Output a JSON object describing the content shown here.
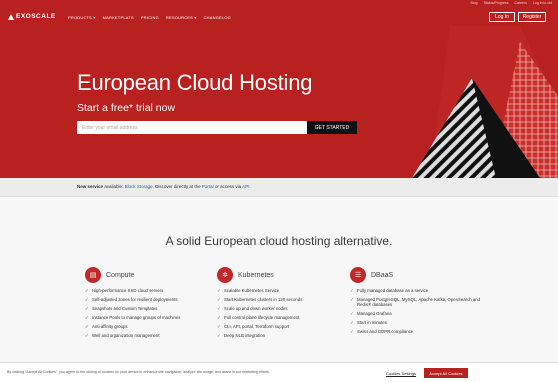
{
  "topbar": {
    "links": [
      "Blog",
      "Status/Progress",
      "Careers",
      "Log in to old"
    ]
  },
  "nav": {
    "logo": "EXOSCALE",
    "menu": [
      "PRODUCTS",
      "MARKETPLATS",
      "PRICING",
      "RESOURCES",
      "CHANGELOG"
    ],
    "login": "Log In",
    "register": "Register"
  },
  "hero": {
    "title": "European Cloud Hosting",
    "subtitle": "Start a free* trial now",
    "email_placeholder": "Enter your email address",
    "cta": "GET STARTED",
    "colors": {
      "brand": "#b8211f",
      "cta": "#111111"
    }
  },
  "news": {
    "label": "New service",
    "text_before": "available:",
    "link1": "Block Storage",
    "text_mid": ". Discover directly at the",
    "link2": "Portal",
    "text_mid2": "or access via",
    "link3": "API",
    "text_end": "."
  },
  "main": {
    "title": "A solid European cloud hosting alternative."
  },
  "columns": [
    {
      "title": "Compute",
      "icon": "server-icon",
      "items": [
        "High-performance SSD cloud servers",
        "Self-adjusted zones for resilient deployments",
        "Snapshots and Custom Templates",
        "Instance Pools to manage groups of machines",
        "Anti-affinity groups",
        "Well and organization management"
      ]
    },
    {
      "title": "Kubernetes",
      "icon": "kubernetes-icon",
      "items": [
        "Scalable Kubernetes Service",
        "Start Kubernetes clusters in 120 seconds",
        "Scale up and down worker nodes",
        "Full control plane lifecycle management",
        "CLI, API, portal, Terraform support",
        "Deep NLB integration"
      ]
    },
    {
      "title": "DBaaS",
      "icon": "database-icon",
      "items": [
        "Fully managed database as a service",
        "Managed PostgreSQL, MySQL, Apache Kafka, OpenSearch and Redis® databases",
        "Managed Grafana",
        "Start in minutes",
        "Swiss and GDPR compliance"
      ]
    }
  ],
  "cookie": {
    "text": "By clicking “Accept All Cookies”, you agree to the storing of cookies on your device to enhance site navigation, analyze site usage, and assist in our marketing efforts.",
    "settings": "Cookies Settings",
    "accept": "Accept All Cookies"
  }
}
